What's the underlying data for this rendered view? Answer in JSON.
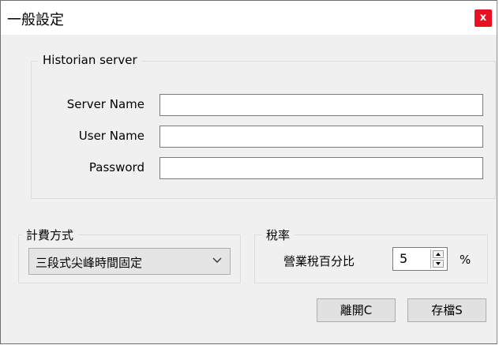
{
  "window": {
    "title": "一般設定",
    "close_label": "x"
  },
  "historian": {
    "legend": "Historian server",
    "server_name_label": "Server Name",
    "server_name_value": "",
    "user_name_label": "User Name",
    "user_name_value": "",
    "password_label": "Password",
    "password_value": ""
  },
  "billing": {
    "legend": "計費方式",
    "selected": "三段式尖峰時間固定"
  },
  "tax": {
    "legend": "稅率",
    "label": "營業稅百分比",
    "value": "5",
    "unit": "%"
  },
  "buttons": {
    "leave": "離開C",
    "save": "存檔S"
  }
}
